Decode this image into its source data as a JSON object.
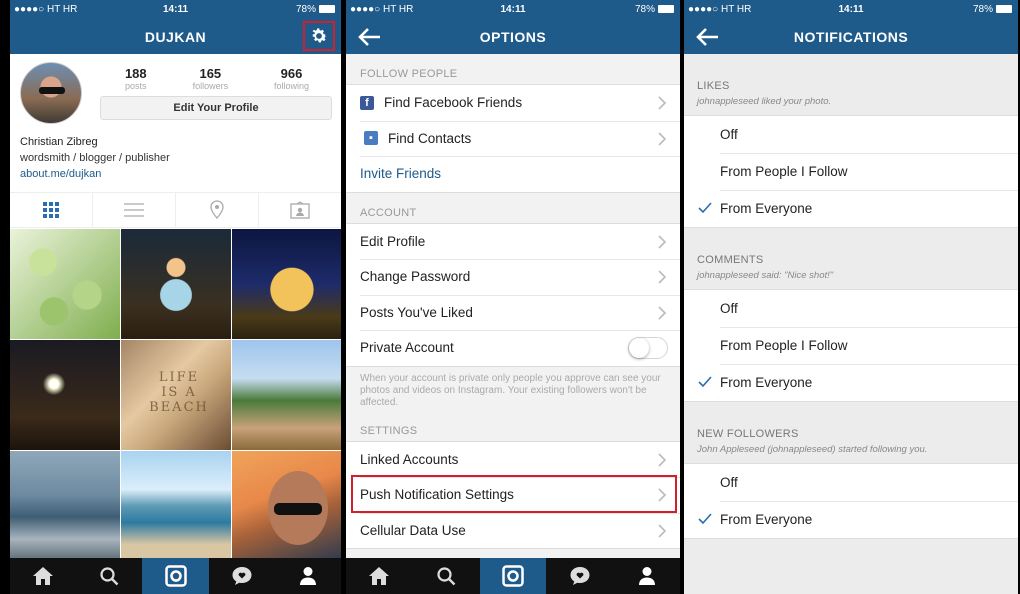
{
  "status": {
    "carrier": "●●●●○ HT HR",
    "time": "14:11",
    "battery": "78%"
  },
  "profile": {
    "title": "DUJKAN",
    "stats": [
      {
        "num": "188",
        "label": "posts"
      },
      {
        "num": "165",
        "label": "followers"
      },
      {
        "num": "966",
        "label": "following"
      }
    ],
    "edit_button": "Edit Your Profile",
    "bio_name": "Christian Zibreg",
    "bio_line": "wordsmith / blogger / publisher",
    "bio_link": "about.me/dujkan",
    "photo_text": "LIFE IS A BEACH"
  },
  "options": {
    "title": "OPTIONS",
    "follow_header": "FOLLOW PEOPLE",
    "find_facebook": "Find Facebook Friends",
    "find_contacts": "Find Contacts",
    "invite": "Invite Friends",
    "account_header": "ACCOUNT",
    "edit_profile": "Edit Profile",
    "change_password": "Change Password",
    "posts_liked": "Posts You've Liked",
    "private_account": "Private Account",
    "private_account_on": false,
    "private_note": "When your account is private only people you approve can see your photos and videos on Instagram. Your existing followers won't be affected.",
    "settings_header": "SETTINGS",
    "linked_accounts": "Linked Accounts",
    "push_settings": "Push Notification Settings",
    "cellular": "Cellular Data Use"
  },
  "notifications": {
    "title": "NOTIFICATIONS",
    "likes": {
      "header": "LIKES",
      "desc": "johnappleseed liked your photo.",
      "opt_off": "Off",
      "opt_follow": "From People I Follow",
      "opt_everyone": "From Everyone",
      "selected": "From Everyone"
    },
    "comments": {
      "header": "COMMENTS",
      "desc": "johnappleseed said: \"Nice shot!\"",
      "opt_off": "Off",
      "opt_follow": "From People I Follow",
      "opt_everyone": "From Everyone",
      "selected": "From Everyone"
    },
    "new_followers": {
      "header": "NEW FOLLOWERS",
      "desc": "John Appleseed (johnappleseed) started following you.",
      "opt_off": "Off",
      "opt_everyone": "From Everyone",
      "selected": "From Everyone"
    }
  },
  "icons": {
    "gear": "gear-icon",
    "back": "back-arrow-icon",
    "chevron": "chevron-right-icon",
    "home": "home-icon",
    "search": "search-icon",
    "camera": "camera-icon",
    "activity": "activity-icon",
    "profile": "profile-icon",
    "grid": "grid-view-icon",
    "list": "list-view-icon",
    "location": "location-icon",
    "tagged": "tagged-photos-icon"
  },
  "colors": {
    "brand_blue": "#1e5a8a",
    "highlight_red": "#d21f2c",
    "tab_dark": "#111111"
  }
}
